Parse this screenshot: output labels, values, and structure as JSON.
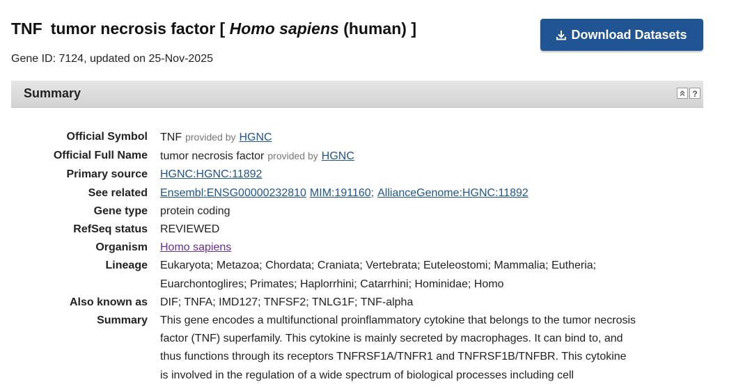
{
  "header": {
    "symbol": "TNF",
    "name_prefix": "tumor necrosis factor [ ",
    "organism_italic": "Homo sapiens",
    "name_suffix": " (human) ]",
    "gene_meta": "Gene ID: 7124, updated on 25-Nov-2025",
    "download_label": "Download Datasets",
    "download_icon": "download-icon"
  },
  "section": {
    "title": "Summary",
    "icons": [
      "collapse-up-icon",
      "help-icon"
    ],
    "help_glyph": "?"
  },
  "fields": {
    "official_symbol": {
      "label": "Official Symbol",
      "value": "TNF",
      "provided_by": "provided by",
      "source_link": "HGNC"
    },
    "official_full_name": {
      "label": "Official Full Name",
      "value": "tumor necrosis factor",
      "provided_by": "provided by",
      "source_link": "HGNC"
    },
    "primary_source": {
      "label": "Primary source",
      "link": "HGNC:HGNC:11892"
    },
    "see_related": {
      "label": "See related",
      "links": [
        "Ensembl:ENSG00000232810",
        "MIM:191160;",
        "AllianceGenome:HGNC:11892"
      ]
    },
    "gene_type": {
      "label": "Gene type",
      "value": "protein coding"
    },
    "refseq_status": {
      "label": "RefSeq status",
      "value": "REVIEWED"
    },
    "organism": {
      "label": "Organism",
      "link": "Homo sapiens"
    },
    "lineage": {
      "label": "Lineage",
      "line1": "Eukaryota; Metazoa; Chordata; Craniata; Vertebrata; Euteleostomi; Mammalia; Eutheria;",
      "line2": "Euarchontoglires; Primates; Haplorrhini; Catarrhini; Hominidae; Homo"
    },
    "also_known_as": {
      "label": "Also known as",
      "value": "DIF; TNFA; IMD127; TNFSF2; TNLG1F; TNF-alpha"
    },
    "summary": {
      "label": "Summary",
      "line1": "This gene encodes a multifunctional proinflammatory cytokine that belongs to the tumor necrosis",
      "line2": "factor (TNF) superfamily. This cytokine is mainly secreted by macrophages. It can bind to, and",
      "line3": "thus functions through its receptors TNFRSF1A/TNFR1 and TNFRSF1B/TNFBR. This cytokine",
      "line4": "is involved in the regulation of a wide spectrum of biological processes including cell"
    }
  },
  "colors": {
    "button_bg": "#205493",
    "link": "#20558a",
    "visited_link": "#6a2d91",
    "section_bar": "#dcdcdc"
  }
}
